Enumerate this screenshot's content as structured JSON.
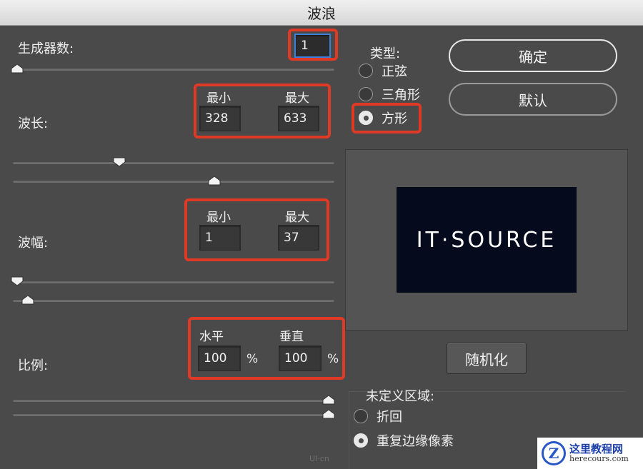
{
  "dialog": {
    "title": "波浪"
  },
  "generators": {
    "label": "生成器数:",
    "value": "1",
    "slider_fraction": 0.0
  },
  "wavelength": {
    "label": "波长:",
    "min_label": "最小",
    "max_label": "最大",
    "min_value": "328",
    "max_value": "633",
    "min_slider_fraction": 0.33,
    "max_slider_fraction": 0.63
  },
  "amplitude": {
    "label": "波幅:",
    "min_label": "最小",
    "max_label": "最大",
    "min_value": "1",
    "max_value": "37",
    "min_slider_fraction": 0.0,
    "max_slider_fraction": 0.04
  },
  "scale": {
    "label": "比例:",
    "h_label": "水平",
    "v_label": "垂直",
    "h_value": "100",
    "v_value": "100",
    "unit": "%",
    "h_slider_fraction": 1.0,
    "v_slider_fraction": 1.0
  },
  "type": {
    "label": "类型:",
    "options": [
      "正弦",
      "三角形",
      "方形"
    ],
    "selected": "方形"
  },
  "buttons": {
    "ok": "确定",
    "default": "默认",
    "randomize": "随机化"
  },
  "preview": {
    "text": "IT·SOURCE"
  },
  "undefined_area": {
    "label": "未定义区域:",
    "options": [
      "折回",
      "重复边缘像素"
    ],
    "selected": "重复边缘像素"
  },
  "watermarks": {
    "site_title": "这里教程网",
    "site_url": "herecours.com",
    "logo_letter": "Z",
    "corner_mark": "UI·cn"
  },
  "colors": {
    "highlight": "#e03a26",
    "focus": "#3c7fd8",
    "panel": "#4a4a4a"
  }
}
